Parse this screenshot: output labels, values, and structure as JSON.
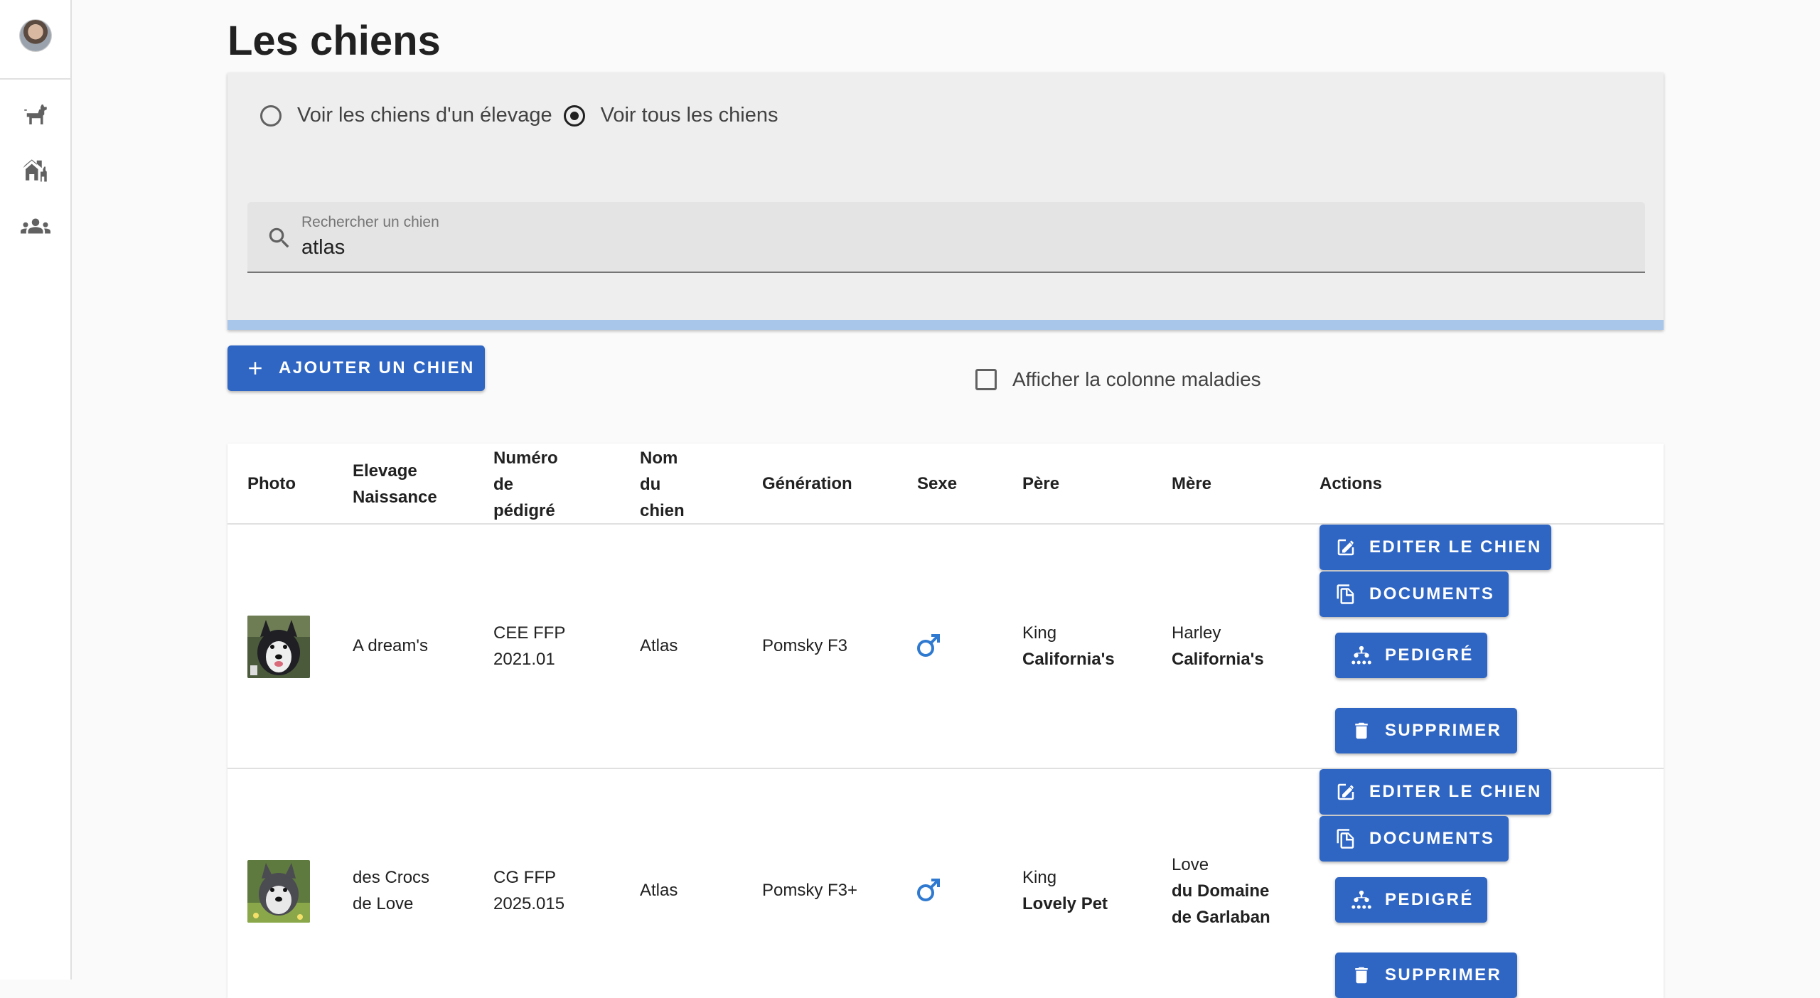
{
  "page": {
    "title": "Les chiens"
  },
  "sidebar": {
    "items": [
      {
        "name": "dog-icon"
      },
      {
        "name": "kennel-icon"
      },
      {
        "name": "people-icon"
      }
    ]
  },
  "filters": {
    "radio_kennel_label": "Voir les chiens d'un élevage",
    "radio_all_label": "Voir tous les chiens",
    "selected": "all",
    "search_label": "Rechercher un chien",
    "search_value": "atlas"
  },
  "toolbar": {
    "add_label": "Ajouter un chien",
    "checkbox_label": "Afficher la colonne maladies",
    "checkbox_checked": false
  },
  "table": {
    "headers": {
      "photo": "Photo",
      "elevage_line1": "Elevage",
      "elevage_line2": "Naissance",
      "numero_line1": "Numéro",
      "numero_line2": "de",
      "numero_line3": "pédigré",
      "nom_line1": "Nom",
      "nom_line2": "du",
      "nom_line3": "chien",
      "generation": "Génération",
      "sexe": "Sexe",
      "pere": "Père",
      "mere": "Mère",
      "actions": "Actions"
    },
    "rows": [
      {
        "elevage_line1": "A dream's",
        "elevage_line2": "",
        "numero_line1": "CEE FFP",
        "numero_line2": "2021.01",
        "nom": "Atlas",
        "generation": "Pomsky F3",
        "sexe": "male",
        "pere_line1": "King",
        "pere_line2": "California's",
        "mere_line1": "Harley",
        "mere_line2": "California's",
        "mere_line3": ""
      },
      {
        "elevage_line1": "des Crocs",
        "elevage_line2": "de Love",
        "numero_line1": "CG FFP",
        "numero_line2": "2025.015",
        "nom": "Atlas",
        "generation": "Pomsky F3+",
        "sexe": "male",
        "pere_line1": "King",
        "pere_line2": "Lovely Pet",
        "mere_line1": "Love",
        "mere_line2": "du Domaine",
        "mere_line3": "de Garlaban"
      }
    ],
    "actions": {
      "edit": "Editer le chien",
      "documents": "Documents",
      "pedigree": "Pedigré",
      "delete": "Supprimer"
    }
  },
  "colors": {
    "primary": "#2f66c4",
    "male": "#2f7ad0",
    "progress": "#a7c6ea"
  }
}
